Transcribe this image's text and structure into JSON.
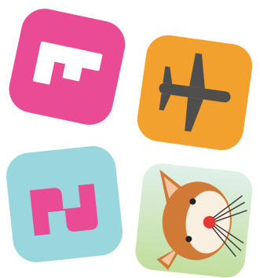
{
  "icons": [
    {
      "name": "f-letter-icon",
      "glyph": "F",
      "background": "#e94c95",
      "foreground": "#ffffff"
    },
    {
      "name": "airplane-icon",
      "glyph": "airplane",
      "background": "#f3a12e",
      "foreground": "#4f4e4d"
    },
    {
      "name": "z-letter-icon",
      "glyph": "Z",
      "background": "#9ad6de",
      "foreground": "#e94c95"
    },
    {
      "name": "cat-face-icon",
      "glyph": "cat",
      "background_top": "#e0f0ea",
      "background_bottom": "#c1de9c",
      "foreground": "#d07a38"
    }
  ]
}
